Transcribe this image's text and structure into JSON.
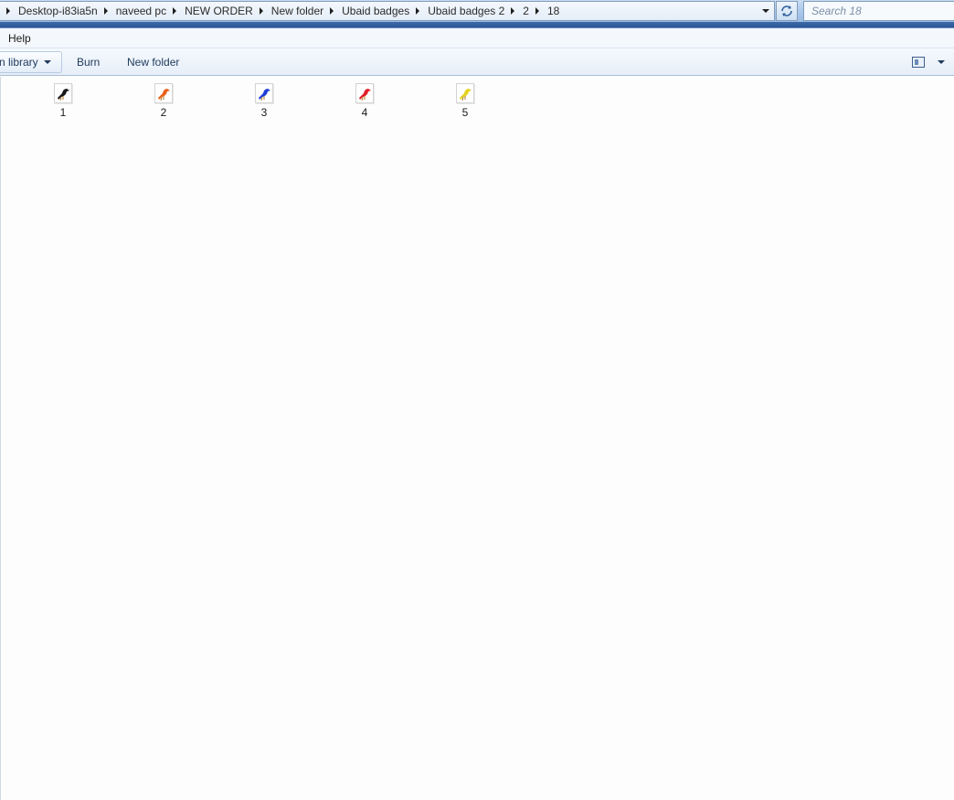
{
  "address_bar": {
    "breadcrumbs": [
      "Desktop-i83ia5n",
      "naveed pc",
      "NEW ORDER",
      "New folder",
      "Ubaid badges",
      "Ubaid badges 2",
      "2",
      "18"
    ]
  },
  "search": {
    "placeholder": "Search 18"
  },
  "menu": {
    "items": [
      "Help"
    ]
  },
  "toolbar": {
    "include_in_library_label": "n library",
    "burn_label": "Burn",
    "new_folder_label": "New folder"
  },
  "files": [
    {
      "name": "1",
      "icon": "bird-black-icon",
      "color": "#1a1a1a"
    },
    {
      "name": "2",
      "icon": "bird-orange-icon",
      "color": "#e8621a"
    },
    {
      "name": "3",
      "icon": "bird-blue-icon",
      "color": "#1e3fd6"
    },
    {
      "name": "4",
      "icon": "bird-red-icon",
      "color": "#e0202a"
    },
    {
      "name": "5",
      "icon": "bird-yellow-icon",
      "color": "#e6d21c"
    }
  ]
}
